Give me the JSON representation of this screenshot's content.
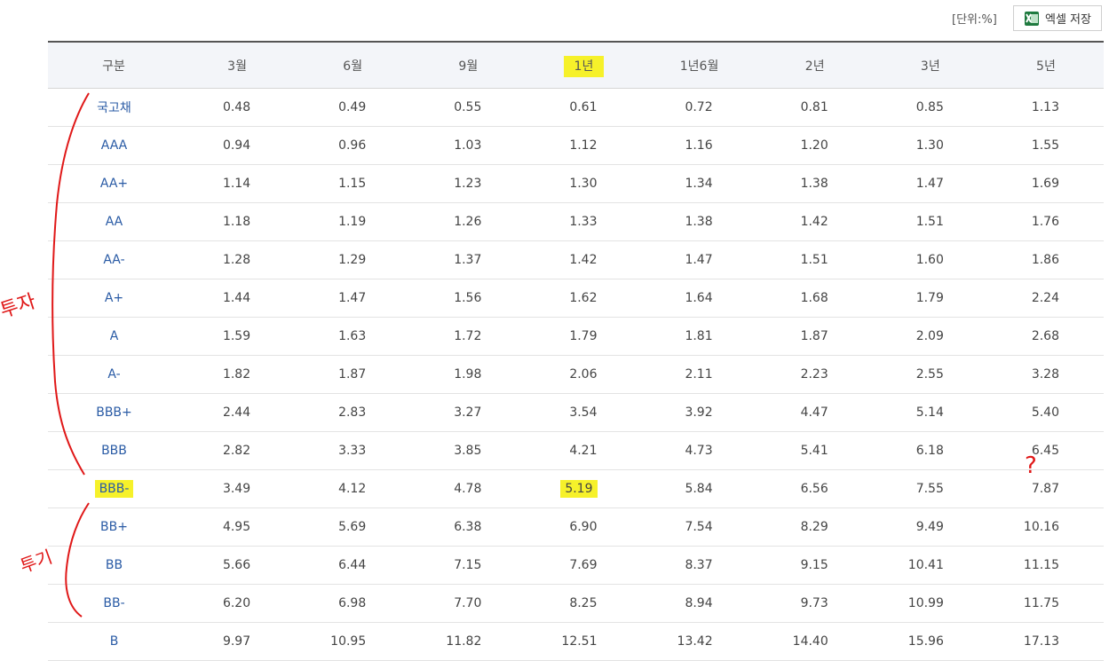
{
  "unit_label": "[단위:%]",
  "excel_button": {
    "label": "엑셀 저장",
    "icon": "excel-icon"
  },
  "table": {
    "headers": [
      "구분",
      "3월",
      "6월",
      "9월",
      "1년",
      "1년6월",
      "2년",
      "3년",
      "5년"
    ],
    "rows": [
      {
        "grade": "국고채",
        "values": [
          "0.48",
          "0.49",
          "0.55",
          "0.61",
          "0.72",
          "0.81",
          "0.85",
          "1.13"
        ]
      },
      {
        "grade": "AAA",
        "values": [
          "0.94",
          "0.96",
          "1.03",
          "1.12",
          "1.16",
          "1.20",
          "1.30",
          "1.55"
        ]
      },
      {
        "grade": "AA+",
        "values": [
          "1.14",
          "1.15",
          "1.23",
          "1.30",
          "1.34",
          "1.38",
          "1.47",
          "1.69"
        ]
      },
      {
        "grade": "AA",
        "values": [
          "1.18",
          "1.19",
          "1.26",
          "1.33",
          "1.38",
          "1.42",
          "1.51",
          "1.76"
        ]
      },
      {
        "grade": "AA-",
        "values": [
          "1.28",
          "1.29",
          "1.37",
          "1.42",
          "1.47",
          "1.51",
          "1.60",
          "1.86"
        ]
      },
      {
        "grade": "A+",
        "values": [
          "1.44",
          "1.47",
          "1.56",
          "1.62",
          "1.64",
          "1.68",
          "1.79",
          "2.24"
        ]
      },
      {
        "grade": "A",
        "values": [
          "1.59",
          "1.63",
          "1.72",
          "1.79",
          "1.81",
          "1.87",
          "2.09",
          "2.68"
        ]
      },
      {
        "grade": "A-",
        "values": [
          "1.82",
          "1.87",
          "1.98",
          "2.06",
          "2.11",
          "2.23",
          "2.55",
          "3.28"
        ]
      },
      {
        "grade": "BBB+",
        "values": [
          "2.44",
          "2.83",
          "3.27",
          "3.54",
          "3.92",
          "4.47",
          "5.14",
          "5.40"
        ]
      },
      {
        "grade": "BBB",
        "values": [
          "2.82",
          "3.33",
          "3.85",
          "4.21",
          "4.73",
          "5.41",
          "6.18",
          "6.45"
        ]
      },
      {
        "grade": "BBB-",
        "values": [
          "3.49",
          "4.12",
          "4.78",
          "5.19",
          "5.84",
          "6.56",
          "7.55",
          "7.87"
        ]
      },
      {
        "grade": "BB+",
        "values": [
          "4.95",
          "5.69",
          "6.38",
          "6.90",
          "7.54",
          "8.29",
          "9.49",
          "10.16"
        ]
      },
      {
        "grade": "BB",
        "values": [
          "5.66",
          "6.44",
          "7.15",
          "7.69",
          "8.37",
          "9.15",
          "10.41",
          "11.15"
        ]
      },
      {
        "grade": "BB-",
        "values": [
          "6.20",
          "6.98",
          "7.70",
          "8.25",
          "8.94",
          "9.73",
          "10.99",
          "11.75"
        ]
      },
      {
        "grade": "B",
        "values": [
          "9.97",
          "10.95",
          "11.82",
          "12.51",
          "13.42",
          "14.40",
          "15.96",
          "17.13"
        ]
      }
    ],
    "highlights": {
      "header": "1년",
      "grade": "BBB-",
      "cell": "5.19"
    }
  },
  "annotations": {
    "investment_label": "투자",
    "speculative_label": "투기",
    "question_mark": "?",
    "ink_color": "#e01818",
    "highlight_color": "#f6f12a"
  }
}
